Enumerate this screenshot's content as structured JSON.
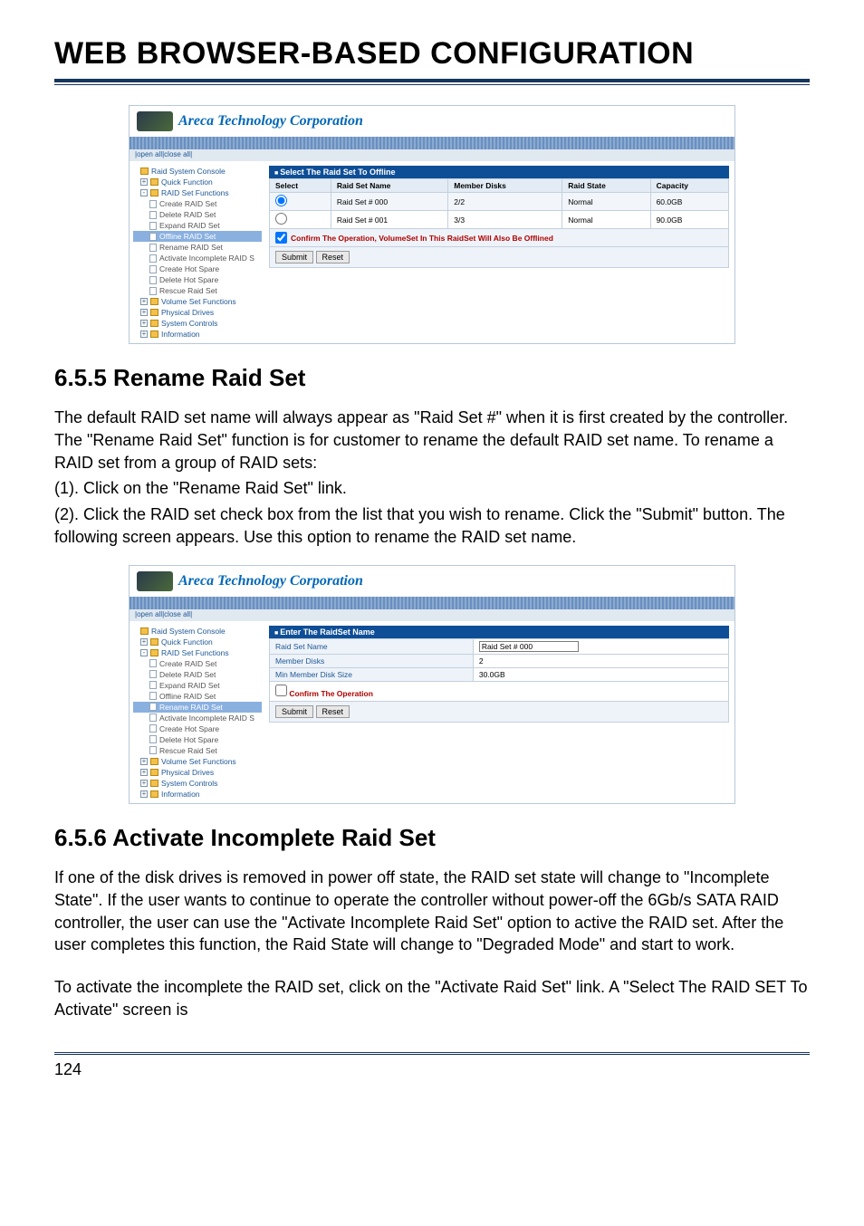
{
  "doc": {
    "title": "WEB BROWSER-BASED CONFIGURATION",
    "page_number": "124"
  },
  "sections": {
    "s1": {
      "heading": "6.5.5 Rename Raid Set"
    },
    "s2": {
      "heading": "6.5.6 Activate Incomplete Raid Set"
    }
  },
  "paragraphs": {
    "p1": "The default RAID set name will always appear as \"Raid Set #\" when it is first created by the controller. The \"Rename Raid Set\" function is for customer to rename the default RAID set name. To rename a RAID set from a group of RAID sets:",
    "p1a": "(1). Click on the \"Rename Raid Set\" link.",
    "p1b": "(2). Click the RAID set check box from the list that you wish to rename. Click the \"Submit\" button. The following screen appears. Use this option to rename the RAID set name.",
    "p2": "If one of the disk drives is removed in power off state, the RAID set state will change to \"Incomplete State\". If the user wants to continue to operate the controller without power-off the 6Gb/s SATA RAID controller, the user can use the \"Activate Incomplete Raid Set\" option to active the RAID set. After the user completes this function, the Raid State will change to \"Degraded Mode\" and start to work.",
    "p3": "To activate the incomplete the RAID set, click on the \"Activate Raid Set\" link. A \"Select The RAID SET To Activate\" screen is"
  },
  "shot1": {
    "brand": "Areca Technology Corporation",
    "toolbar": "|open all|close all|",
    "tree": {
      "root": "Raid System Console",
      "quick": "Quick Function",
      "raidset": "RAID Set Functions",
      "create": "Create RAID Set",
      "delete": "Delete RAID Set",
      "expand": "Expand RAID Set",
      "offline": "Offline RAID Set",
      "rename": "Rename RAID Set",
      "activate": "Activate Incomplete RAID S",
      "chs": "Create Hot Spare",
      "dhs": "Delete Hot Spare",
      "rescue": "Rescue Raid Set",
      "volset": "Volume Set Functions",
      "phys": "Physical Drives",
      "sysc": "System Controls",
      "info": "Information"
    },
    "panel_title": "Select The Raid Set To Offline",
    "cols": {
      "sel": "Select",
      "name": "Raid Set Name",
      "mem": "Member Disks",
      "state": "Raid State",
      "cap": "Capacity"
    },
    "rows": [
      {
        "name": "Raid Set # 000",
        "mem": "2/2",
        "state": "Normal",
        "cap": "60.0GB"
      },
      {
        "name": "Raid Set # 001",
        "mem": "3/3",
        "state": "Normal",
        "cap": "90.0GB"
      }
    ],
    "confirm_label": "Confirm The Operation, VolumeSet In This RaidSet Will Also Be Offlined",
    "btn_submit": "Submit",
    "btn_reset": "Reset"
  },
  "shot2": {
    "brand": "Areca Technology Corporation",
    "toolbar": "|open all|close all|",
    "panel_title": "Enter The RaidSet Name",
    "kv": {
      "k1": "Raid Set Name",
      "v1": "Raid Set # 000",
      "k2": "Member Disks",
      "v2": "2",
      "k3": "Min Member Disk Size",
      "v3": "30.0GB"
    },
    "confirm_label": "Confirm The Operation",
    "btn_submit": "Submit",
    "btn_reset": "Reset"
  }
}
